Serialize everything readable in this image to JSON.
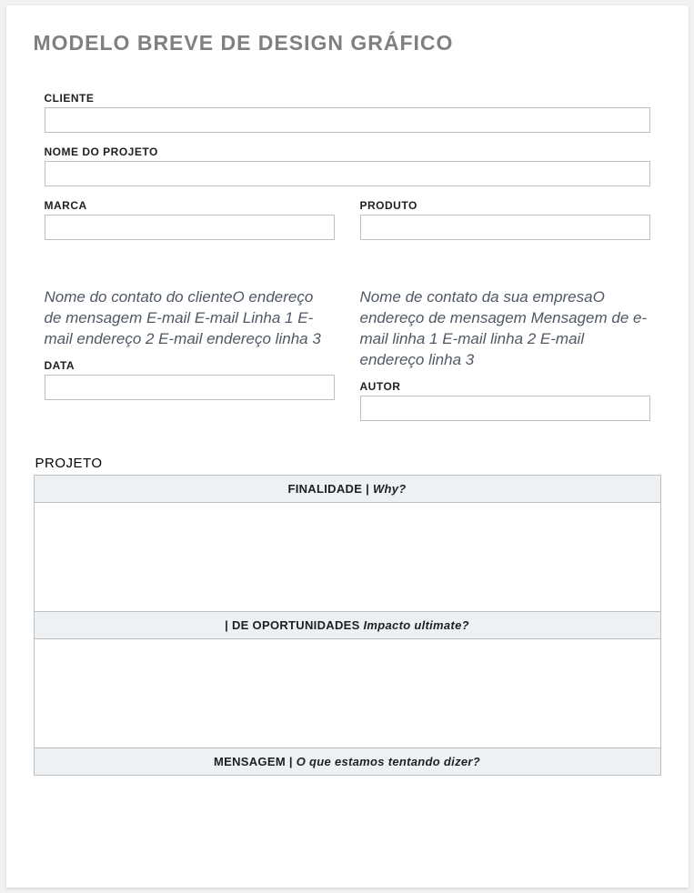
{
  "title": "MODELO BREVE DE DESIGN GRÁFICO",
  "fields": {
    "cliente_label": "CLIENTE",
    "cliente_value": "",
    "projeto_label": "NOME DO PROJETO",
    "projeto_value": "",
    "marca_label": "MARCA",
    "marca_value": "",
    "produto_label": "PRODUTO",
    "produto_value": "",
    "data_label": "DATA",
    "data_value": "",
    "autor_label": "AUTOR",
    "autor_value": ""
  },
  "contacts": {
    "client": "Nome do contato do clienteO endereço de mensagem E-mail E-mail Linha 1 E-mail endereço 2 E-mail endereço linha 3",
    "company": "Nome de contato da sua empresaO endereço de mensagem Mensagem de e-mail linha 1 E-mail linha 2 E-mail endereço linha 3"
  },
  "project": {
    "section_label": "PROJETO",
    "rows": {
      "finalidade_label_a": "FINALIDADE | ",
      "finalidade_label_b": " Why?",
      "finalidade_value": "",
      "oportunidades_label_a": "| DE OPORTUNIDADES ",
      "oportunidades_label_b": " Impacto ultimate?",
      "oportunidades_value": "",
      "mensagem_label_a": "MENSAGEM | ",
      "mensagem_label_b": " O que estamos tentando dizer?",
      "mensagem_value": ""
    }
  }
}
